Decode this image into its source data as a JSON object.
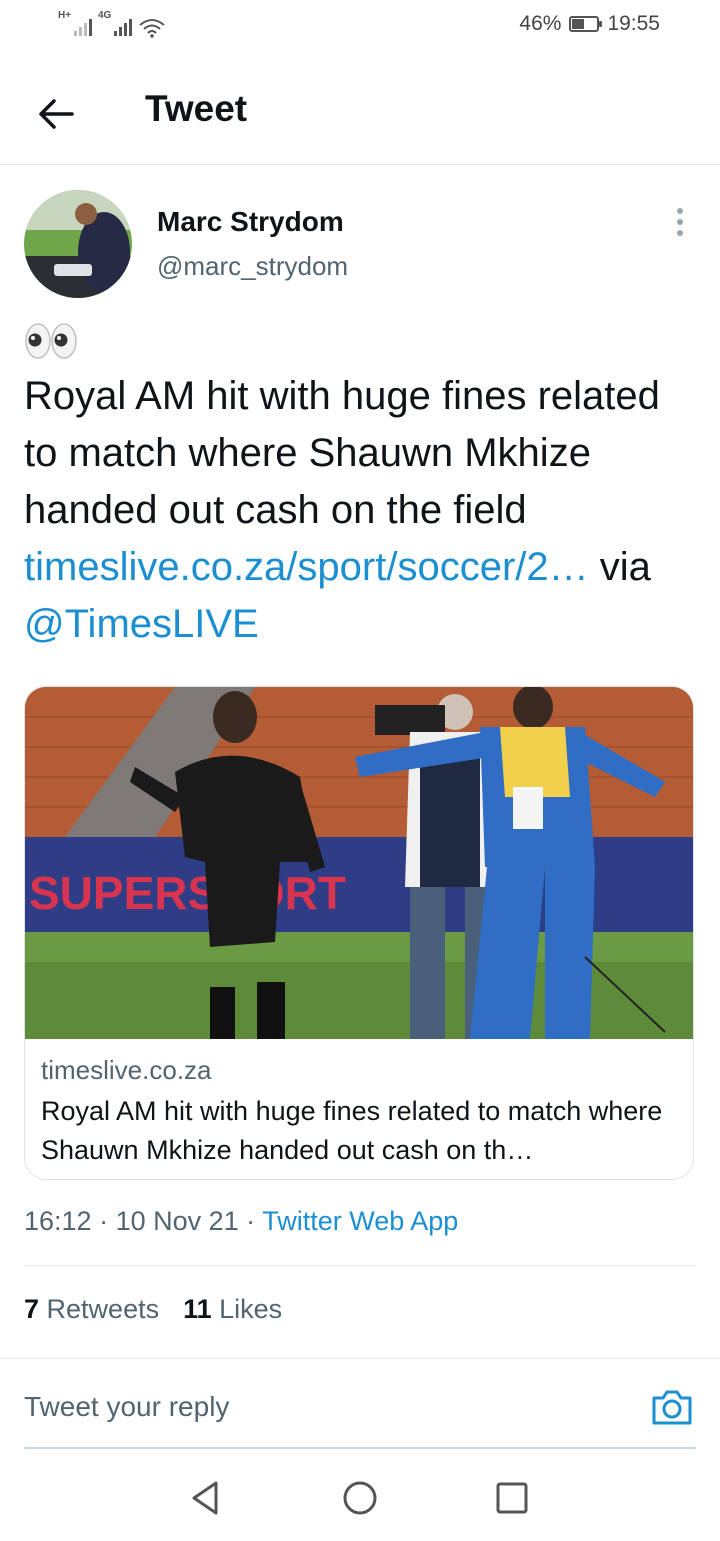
{
  "status_bar": {
    "network_1": "H+",
    "network_2": "4G",
    "battery": "46%",
    "time": "19:55"
  },
  "header": {
    "title": "Tweet",
    "back_icon": "arrow-left-icon"
  },
  "author": {
    "name": "Marc Strydom",
    "handle": "@marc_strydom"
  },
  "tweet": {
    "emoji": "👀",
    "text_plain": "Royal AM hit with huge fines related to match where Shauwn Mkhize handed out cash on the field ",
    "link_url_text": "timeslive.co.za/sport/soccer/2…",
    "via_text": " via ",
    "mention": "@TimesLIVE"
  },
  "card": {
    "domain": "timeslive.co.za",
    "title": "Royal AM hit with huge fines related to match where Shauwn Mkhize handed out cash on th…",
    "image_banner_text": "SUPERSPORT"
  },
  "meta": {
    "time": "16:12",
    "sep1": " · ",
    "date": "10 Nov 21",
    "sep2": " · ",
    "app": "Twitter Web App"
  },
  "stats": {
    "retweets_count": "7",
    "retweets_label": " Retweets",
    "likes_count": "11",
    "likes_label": " Likes"
  },
  "reply": {
    "placeholder": "Tweet your reply",
    "camera_icon": "camera-icon"
  },
  "nav": {
    "back_icon": "nav-back-icon",
    "home_icon": "nav-home-icon",
    "recents_icon": "nav-recents-icon"
  },
  "colors": {
    "link": "#1b8fd2",
    "text": "#0f1419",
    "secondary": "#536471"
  }
}
